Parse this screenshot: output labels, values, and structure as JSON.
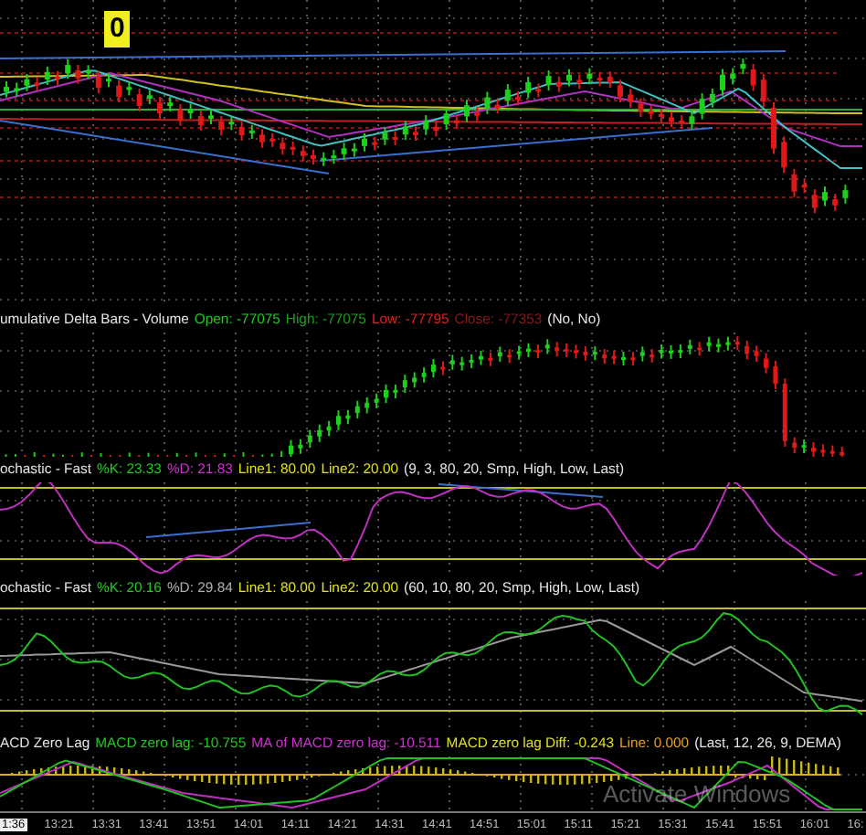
{
  "price_panel": {
    "marker": "0"
  },
  "panels": [
    {
      "kind": "delta",
      "fields": [
        {
          "text": "umulative Delta Bars - Volume",
          "color": "#e6e6e6"
        },
        {
          "text": "Open: -77075",
          "color": "#22c922"
        },
        {
          "text": "High: -77075",
          "color": "#1e9e1e"
        },
        {
          "text": "Low: -77795",
          "color": "#e02020"
        },
        {
          "text": "Close: -77353",
          "color": "#8a1a1a"
        },
        {
          "text": "(No, No)",
          "color": "#e6e6e6"
        }
      ]
    },
    {
      "kind": "stoch_fast",
      "fields": [
        {
          "text": "ochastic - Fast",
          "color": "#e6e6e6"
        },
        {
          "text": "%K: 23.33",
          "color": "#22c922"
        },
        {
          "text": "%D: 21.83",
          "color": "#d030d0"
        },
        {
          "text": "Line1: 80.00",
          "color": "#e0e020"
        },
        {
          "text": "Line2: 20.00",
          "color": "#e0e020"
        },
        {
          "text": "(9, 3, 80, 20, Smp, High, Low, Last)",
          "color": "#e6e6e6"
        }
      ]
    },
    {
      "kind": "stoch_slow",
      "fields": [
        {
          "text": "ochastic - Fast",
          "color": "#e6e6e6"
        },
        {
          "text": "%K: 20.16",
          "color": "#22c922"
        },
        {
          "text": "%D: 29.84",
          "color": "#b0b0b0"
        },
        {
          "text": "Line1: 80.00",
          "color": "#e0e020"
        },
        {
          "text": "Line2: 20.00",
          "color": "#e0e020"
        },
        {
          "text": "(60, 10, 80, 20, Smp, High, Low, Last)",
          "color": "#e6e6e6"
        }
      ]
    },
    {
      "kind": "macd",
      "fields": [
        {
          "text": "ACD Zero Lag",
          "color": "#e6e6e6"
        },
        {
          "text": "MACD zero lag: -10.755",
          "color": "#22c922"
        },
        {
          "text": "MA of MACD zero lag: -10.511",
          "color": "#d030d0"
        },
        {
          "text": "MACD zero lag Diff: -0.243",
          "color": "#e0e020"
        },
        {
          "text": "Line: 0.000",
          "color": "#e8a020"
        },
        {
          "text": "(Last, 12, 26, 9, DEMA)",
          "color": "#e6e6e6"
        }
      ]
    }
  ],
  "time_axis": {
    "cursor_label": "1:36",
    "labels": [
      "13:21",
      "13:31",
      "13:41",
      "13:51",
      "14:01",
      "14:11",
      "14:21",
      "14:31",
      "14:41",
      "14:51",
      "15:01",
      "15:11",
      "15:21",
      "15:31",
      "15:41",
      "15:51",
      "16:01",
      "16:"
    ]
  },
  "os_overlay": "Activate Windows"
}
